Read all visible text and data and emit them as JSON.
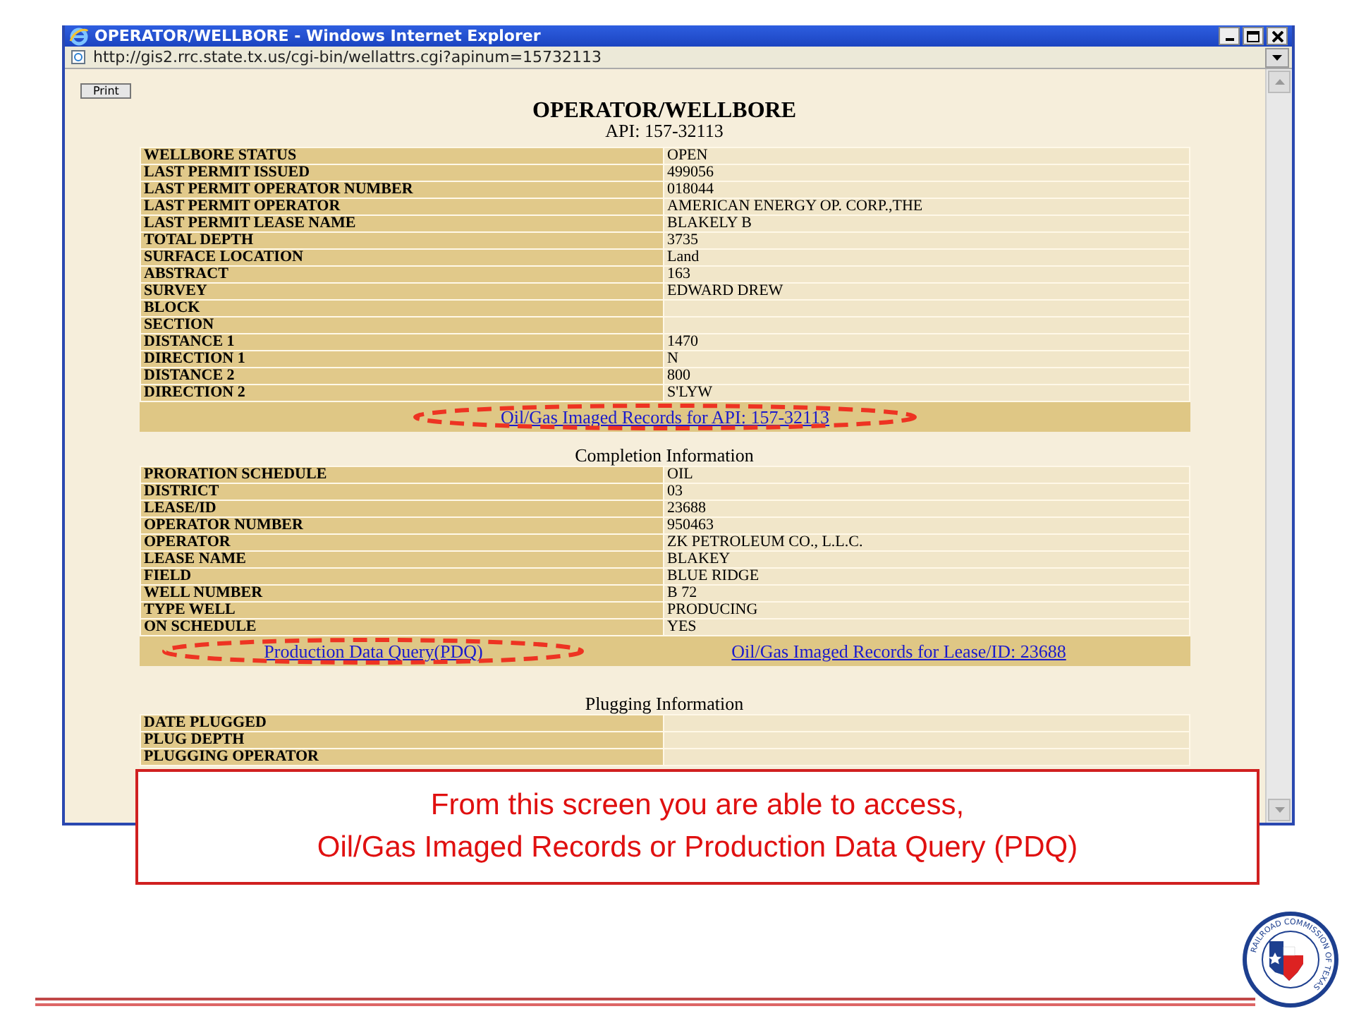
{
  "window": {
    "title": "OPERATOR/WELLBORE - Windows Internet Explorer",
    "address": "http://gis2.rrc.state.tx.us/cgi-bin/wellattrs.cgi?apinum=15732113"
  },
  "page": {
    "print_button": "Print",
    "heading": "OPERATOR/WELLBORE",
    "subheading": "API: 157-32113",
    "sections": [
      {
        "rows": [
          {
            "label": "WELLBORE STATUS",
            "value": "OPEN"
          },
          {
            "label": "LAST PERMIT ISSUED",
            "value": "499056"
          },
          {
            "label": "LAST PERMIT OPERATOR NUMBER",
            "value": "018044"
          },
          {
            "label": "LAST PERMIT OPERATOR",
            "value": "AMERICAN ENERGY OP. CORP.,THE"
          },
          {
            "label": "LAST PERMIT LEASE NAME",
            "value": "BLAKELY B"
          },
          {
            "label": "TOTAL DEPTH",
            "value": "3735"
          },
          {
            "label": "SURFACE LOCATION",
            "value": "Land"
          },
          {
            "label": "ABSTRACT",
            "value": "163"
          },
          {
            "label": "SURVEY",
            "value": "EDWARD DREW"
          },
          {
            "label": "BLOCK",
            "value": ""
          },
          {
            "label": "SECTION",
            "value": ""
          },
          {
            "label": "DISTANCE 1",
            "value": "1470"
          },
          {
            "label": "DIRECTION 1",
            "value": "N"
          },
          {
            "label": "DISTANCE 2",
            "value": "800"
          },
          {
            "label": "DIRECTION 2",
            "value": "S'LYW"
          }
        ],
        "links": [
          "Oil/Gas Imaged Records for API: 157-32113"
        ]
      },
      {
        "title": "Completion Information",
        "rows": [
          {
            "label": "PRORATION SCHEDULE",
            "value": "OIL"
          },
          {
            "label": "DISTRICT",
            "value": "03"
          },
          {
            "label": "LEASE/ID",
            "value": "23688"
          },
          {
            "label": "OPERATOR NUMBER",
            "value": "950463"
          },
          {
            "label": "OPERATOR",
            "value": "ZK PETROLEUM CO., L.L.C."
          },
          {
            "label": "LEASE NAME",
            "value": "BLAKEY"
          },
          {
            "label": "FIELD",
            "value": "BLUE RIDGE"
          },
          {
            "label": "WELL NUMBER",
            "value": "B 72"
          },
          {
            "label": "TYPE WELL",
            "value": "PRODUCING"
          },
          {
            "label": "ON SCHEDULE",
            "value": "YES"
          }
        ],
        "links": [
          "Production Data Query(PDQ)",
          "Oil/Gas Imaged Records for Lease/ID: 23688"
        ]
      },
      {
        "title": "Plugging Information",
        "rows": [
          {
            "label": "DATE PLUGGED",
            "value": ""
          },
          {
            "label": "PLUG DEPTH",
            "value": ""
          },
          {
            "label": "PLUGGING OPERATOR",
            "value": ""
          }
        ]
      }
    ]
  },
  "callout": {
    "lines": [
      "From this screen you are able to access,",
      "Oil/Gas Imaged Records or Production Data Query (PDQ)"
    ]
  },
  "seal": {
    "text": "RAILROAD COMMISSION OF TEXAS"
  }
}
